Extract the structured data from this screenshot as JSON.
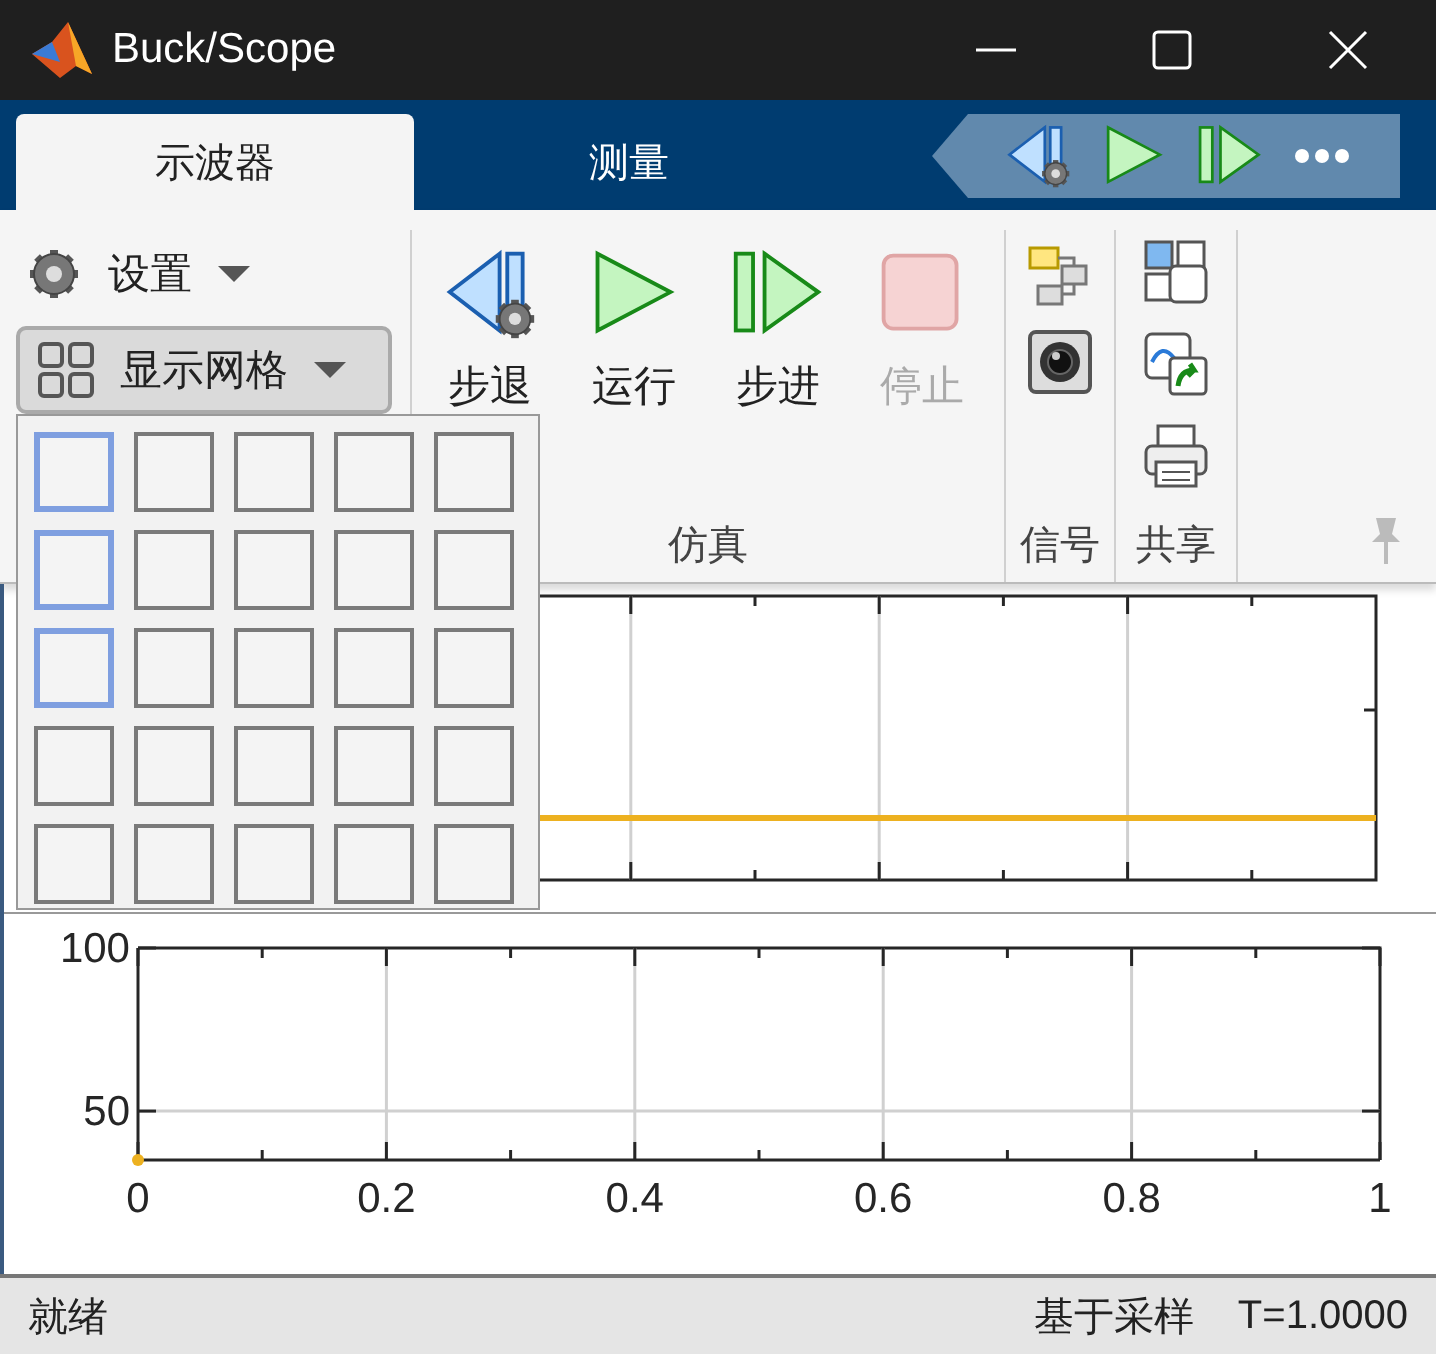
{
  "window": {
    "title": "Buck/Scope"
  },
  "tabs": [
    {
      "label": "示波器",
      "selected": true
    },
    {
      "label": "测量",
      "selected": false
    }
  ],
  "quick_access": [
    {
      "kind": "step-back"
    },
    {
      "kind": "run"
    },
    {
      "kind": "step-forward"
    },
    {
      "kind": "more"
    }
  ],
  "ribbon": {
    "settings": {
      "label": "设置"
    },
    "layout_button": {
      "label": "显示网格",
      "expanded": true
    },
    "simulation": {
      "title": "仿真",
      "buttons": [
        {
          "kind": "step-back",
          "label": "步退",
          "disabled": false
        },
        {
          "kind": "run",
          "label": "运行",
          "disabled": false
        },
        {
          "kind": "step-forward",
          "label": "步进",
          "disabled": false
        },
        {
          "kind": "stop",
          "label": "停止",
          "disabled": true
        }
      ]
    },
    "signals": {
      "title": "信号",
      "buttons": [
        {
          "kind": "highlight"
        },
        {
          "kind": "snapshot"
        }
      ]
    },
    "share": {
      "title": "共享",
      "buttons": [
        {
          "kind": "layout"
        },
        {
          "kind": "copy"
        },
        {
          "kind": "print"
        }
      ]
    }
  },
  "layout_picker": {
    "rows": [
      {
        "cells": [
          {
            "selected": true
          },
          {
            "selected": false
          },
          {
            "selected": false
          },
          {
            "selected": false
          },
          {
            "selected": false
          }
        ]
      },
      {
        "cells": [
          {
            "selected": true
          },
          {
            "selected": false
          },
          {
            "selected": false
          },
          {
            "selected": false
          },
          {
            "selected": false
          }
        ]
      },
      {
        "cells": [
          {
            "selected": true
          },
          {
            "selected": false
          },
          {
            "selected": false
          },
          {
            "selected": false
          },
          {
            "selected": false
          }
        ]
      },
      {
        "cells": [
          {
            "selected": false
          },
          {
            "selected": false
          },
          {
            "selected": false
          },
          {
            "selected": false
          },
          {
            "selected": false
          }
        ]
      },
      {
        "cells": [
          {
            "selected": false
          },
          {
            "selected": false
          },
          {
            "selected": false
          },
          {
            "selected": false
          },
          {
            "selected": false
          }
        ]
      }
    ]
  },
  "plots": [
    {
      "kind": "picture"
    },
    {
      "kind": "chart",
      "chart_data": {
        "type": "scatter",
        "x": [
          0
        ],
        "series": [
          {
            "color": "#edb120",
            "values": [
              35
            ]
          }
        ],
        "grid": true,
        "xlim": [
          0,
          1
        ],
        "ylim": [
          35,
          100
        ],
        "xticks": [
          0,
          0.2,
          0.4,
          0.6,
          0.8,
          1
        ],
        "yticks": [
          50,
          100
        ]
      }
    }
  ],
  "status_bar": {
    "state": "就绪",
    "mode": "基于采样",
    "time": "T=1.0000"
  }
}
